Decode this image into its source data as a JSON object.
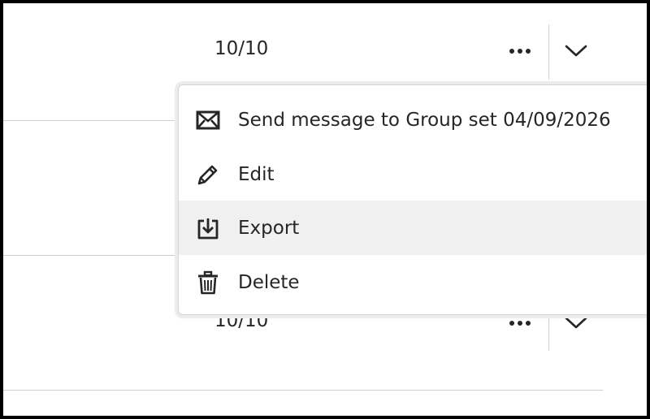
{
  "rows": [
    {
      "score": "10/10"
    },
    {
      "score": "10/10"
    }
  ],
  "menu": {
    "items": [
      {
        "label": "Send message to Group set 04/09/2026",
        "icon": "envelope-icon"
      },
      {
        "label": "Edit",
        "icon": "pencil-icon"
      },
      {
        "label": "Export",
        "icon": "export-icon"
      },
      {
        "label": "Delete",
        "icon": "trash-icon"
      }
    ],
    "hovered_item": "Export"
  },
  "colors": {
    "text": "#262626",
    "divider": "#cfcfcf",
    "hover_bg": "#f0f0f0"
  }
}
